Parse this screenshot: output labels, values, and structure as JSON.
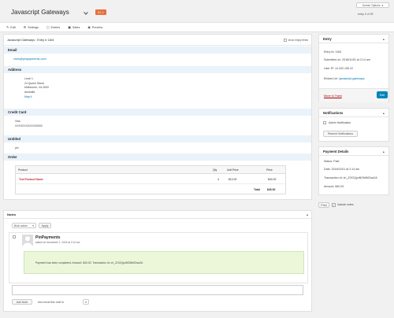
{
  "header": {
    "title": "Javascript Gateways",
    "badge": "ID: 1",
    "screen_options": "Screen Options",
    "entry_counter": "entry 2 of 39"
  },
  "toolbar": {
    "edit": "Edit",
    "settings": "Settings",
    "entries": "Entries",
    "sales": "Sales",
    "preview": "Preview"
  },
  "entry": {
    "heading": "Javascript Gateways : Entry # 1164",
    "show_empty": "show empty fields",
    "email_label": "Email",
    "email_value": "chris@pinpayments.com",
    "address_label": "Address",
    "address_lines": [
      "Level 1",
      "24 Queen Street",
      "Melbourne, Vic 3000",
      "Australia"
    ],
    "map_link": "Map It",
    "cc_label": "Credit Card",
    "cc_type": "Visa",
    "cc_number": "XXXXXXXXXXXX0000",
    "untitled_label": "Untitled",
    "untitled_value": "pin",
    "order_label": "Order",
    "order_columns": [
      "Product",
      "Qty",
      "Unit Price",
      "Price"
    ],
    "order_product": "Test Product Name",
    "order_qty": "4",
    "order_unit_price": "$10.00",
    "order_price": "$40.00",
    "order_total_label": "Total",
    "order_total_value": "$40.00"
  },
  "notes": {
    "title": "Notes",
    "bulk_action": "Bulk action",
    "apply": "Apply",
    "author": "PinPayments",
    "date": "added on November 1, 2018 at 2:14 am",
    "message": "Payment has been completed. Amount: $40.00. Transaction Id: ch_ZOOQpzBGMiMOza2A",
    "add_note": "Add Note",
    "email_note": "Also email this note to"
  },
  "sidebar": {
    "entry_title": "Entry",
    "entry_id": "Entry Id: 1164",
    "submitted": "Submitted on: 2018/11/01 at 2:14 am",
    "user_ip": "User IP: 14.202.155.22",
    "embed_url_label": "Embed Url:",
    "embed_url_value": "/javascript-gateways",
    "trash": "Move to Trash",
    "edit_btn": "Edit",
    "notifications_title": "Notifications",
    "admin_notification": "Admin Notification",
    "resend": "Resend Notifications",
    "payment_title": "Payment Details",
    "status": "Status: Paid",
    "pay_date": "Date: 2018/11/01 at 2:14 am",
    "transaction": "Transaction Id: ch_ZOOQpzBGMiMOza2A",
    "amount": "Amount: $40.00",
    "print_btn": "Print",
    "include_notes": "include notes"
  },
  "colors": {
    "accent": "#0085ba",
    "badge": "#e66f3f",
    "section_bg": "#eaf2fa",
    "note_bg": "#ecf7da",
    "trash": "#a00"
  }
}
